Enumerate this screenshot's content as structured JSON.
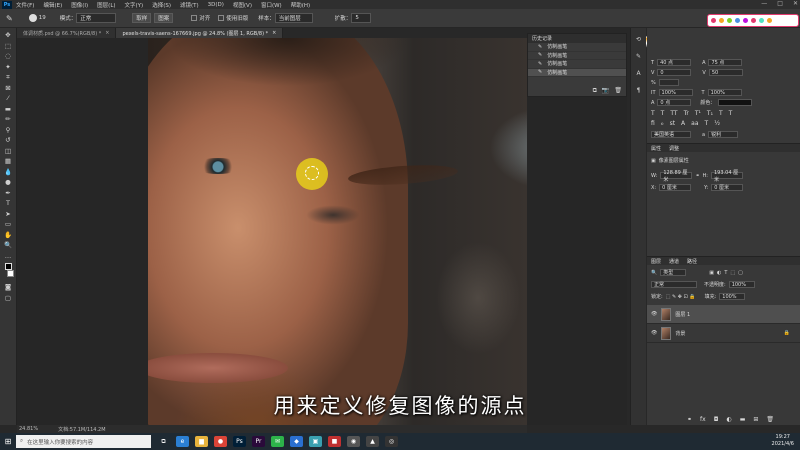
{
  "menubar": {
    "logo": "Ps",
    "items": [
      "文件(F)",
      "编辑(E)",
      "图像(I)",
      "图层(L)",
      "文字(Y)",
      "选择(S)",
      "滤镜(T)",
      "3D(D)",
      "视图(V)",
      "窗口(W)",
      "帮助(H)"
    ],
    "window_controls": [
      "—",
      "□",
      "✕"
    ]
  },
  "options_bar": {
    "brush_size": "19",
    "mode_label": "模式：",
    "mode_value": "正常",
    "source_sampled": "取样",
    "source_pattern": "图案",
    "aligned_label": "对齐",
    "use_legacy_label": "使用旧版",
    "sample_label": "样本：",
    "sample_value": "当前图层",
    "diffusion_label": "扩散：",
    "diffusion_value": "5"
  },
  "tabs": [
    {
      "label": "体调材质.psd @ 66.7%(RGB/8) *",
      "active": false
    },
    {
      "label": "pexels-travis-saens-167669.jpg @ 24.8% (图层 1, RGB/8) *",
      "active": true
    }
  ],
  "status": {
    "zoom": "24.81%",
    "doc": "文档:57.1M/114.2M"
  },
  "subtitle": "用来定义修复图像的源点",
  "history": {
    "title": "历史记录",
    "items": [
      "仿制画笔",
      "仿制画笔",
      "仿制画笔",
      "仿制画笔"
    ],
    "selected_index": 3
  },
  "branding": {
    "name_parts": [
      "w",
      "o",
      "w",
      "i",
      "2",
      "3",
      "4"
    ],
    "colors": [
      "#f5a623",
      "#e94e77",
      "#7ed321",
      "#4a90e2",
      "#f8e71c",
      "#bd10e0",
      "#50e3c2"
    ],
    "learn_label": "学习",
    "badge_dot_colors": [
      "#e23a6e",
      "#f5a623",
      "#7ed321",
      "#4a90e2",
      "#bd10e0",
      "#e23a6e",
      "#50e3c2",
      "#f5a623"
    ]
  },
  "character": {
    "size": "40 点",
    "leading": "75 点",
    "kern": "0",
    "tracking": "50",
    "scale_v": "100%",
    "scale_h": "100%",
    "baseline": "0 点",
    "color_label": "颜色：",
    "language": "美国英语",
    "aa_label": "a",
    "aa_value": "锐利"
  },
  "properties": {
    "tab_properties": "属性",
    "tab_adjust": "调整",
    "layer_label": "像素图层属性",
    "w_label": "W:",
    "w_value": "128.89 厘米",
    "h_label": "H:",
    "h_value": "193.04 厘米",
    "x_label": "X:",
    "x_value": "0 厘米",
    "y_label": "Y:",
    "y_value": "0 厘米"
  },
  "layers": {
    "tabs": [
      "图层",
      "通道",
      "路径"
    ],
    "kind": "类型",
    "blend": "正常",
    "opacity_label": "不透明度:",
    "opacity": "100%",
    "lock_label": "锁定:",
    "fill_label": "填充:",
    "fill": "100%",
    "items": [
      {
        "name": "图层 1",
        "selected": true
      },
      {
        "name": "背景",
        "selected": false
      }
    ]
  },
  "taskbar": {
    "search_placeholder": "在这里输入你要搜索的内容",
    "time": "19:27",
    "date": "2021/4/6",
    "apps": [
      {
        "name": "task-view",
        "glyph": "⧉",
        "color": "#1f2a33"
      },
      {
        "name": "edge",
        "glyph": "e",
        "color": "#2b7fd3"
      },
      {
        "name": "explorer",
        "glyph": "▆",
        "color": "#e8b33c"
      },
      {
        "name": "chrome",
        "glyph": "●",
        "color": "#db4437"
      },
      {
        "name": "photoshop",
        "glyph": "Ps",
        "color": "#001e36"
      },
      {
        "name": "premiere",
        "glyph": "Pr",
        "color": "#2a0a3a"
      },
      {
        "name": "wechat",
        "glyph": "✉",
        "color": "#2db34a"
      },
      {
        "name": "app-8",
        "glyph": "◆",
        "color": "#2a6fd0"
      },
      {
        "name": "app-9",
        "glyph": "▣",
        "color": "#3aa0b0"
      },
      {
        "name": "app-10",
        "glyph": "■",
        "color": "#c03030"
      },
      {
        "name": "app-11",
        "glyph": "◉",
        "color": "#555"
      },
      {
        "name": "app-12",
        "glyph": "▲",
        "color": "#444"
      },
      {
        "name": "app-13",
        "glyph": "◎",
        "color": "#333"
      }
    ]
  }
}
